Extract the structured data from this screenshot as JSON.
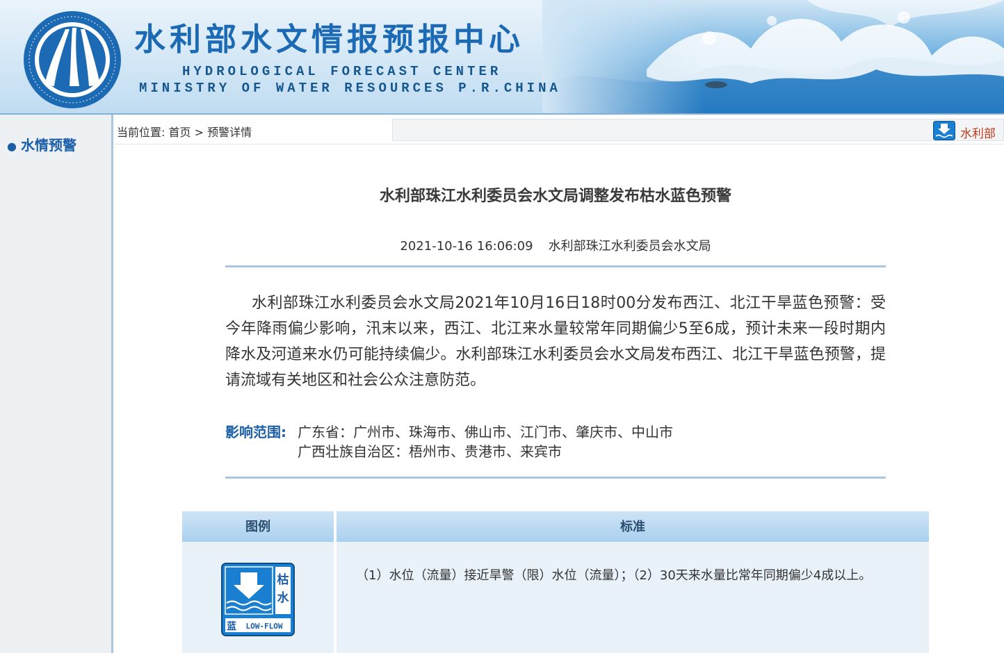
{
  "header": {
    "title_cn": "水利部水文情报预报中心",
    "title_en_line1": "HYDROLOGICAL FORECAST CENTER",
    "title_en_line2": "MINISTRY OF WATER RESOURCES P.R.CHINA",
    "logo_icon": "hydrology-center-emblem-icon",
    "colors": {
      "brand_blue": "#1c6ab3",
      "banner_bg": "#d3e7f6"
    }
  },
  "sidebar": {
    "items": [
      {
        "label": "水情预警",
        "icon": "bullet-dot-icon"
      }
    ]
  },
  "breadcrumb": {
    "prefix": "当前位置:",
    "home": "首页",
    "separator": " > ",
    "current": "预警详情"
  },
  "marquee": {
    "icon": "low-flow-warning-icon",
    "text": "水利部"
  },
  "article": {
    "title": "水利部珠江水利委员会水文局调整发布枯水蓝色预警",
    "datetime": "2021-10-16 16:06:09",
    "publisher": "水利部珠江水利委员会水文局",
    "body": "水利部珠江水利委员会水文局2021年10月16日18时00分发布西江、北江干旱蓝色预警：受今年降雨偏少影响，汛末以来，西江、北江来水量较常年同期偏少5至6成，预计未来一段时期内降水及河道来水仍可能持续偏少。水利部珠江水利委员会水文局发布西江、北江干旱蓝色预警，提请流域有关地区和社会公众注意防范。",
    "scope_label": "影响范围:",
    "scope_lines": [
      "广东省：广州市、珠海市、佛山市、江门市、肇庆市、中山市",
      "广西壮族自治区：梧州市、贵港市、来宾市"
    ]
  },
  "legend_table": {
    "headers": [
      "图例",
      "标准"
    ],
    "rows": [
      {
        "icon": "blue-low-flow-warning-icon",
        "icon_text": {
          "top": "枯",
          "mid": "水",
          "bottom_left": "蓝",
          "bottom_right": "LOW-FLOW"
        },
        "standard": "（1）水位（流量）接近旱警（限）水位（流量）；（2）30天来水量比常年同期偏少4成以上。"
      }
    ],
    "colors": {
      "header_bg": "#a9d0ef",
      "row_bg": "#eaf2f9",
      "icon_blue": "#1a7fd0"
    }
  }
}
